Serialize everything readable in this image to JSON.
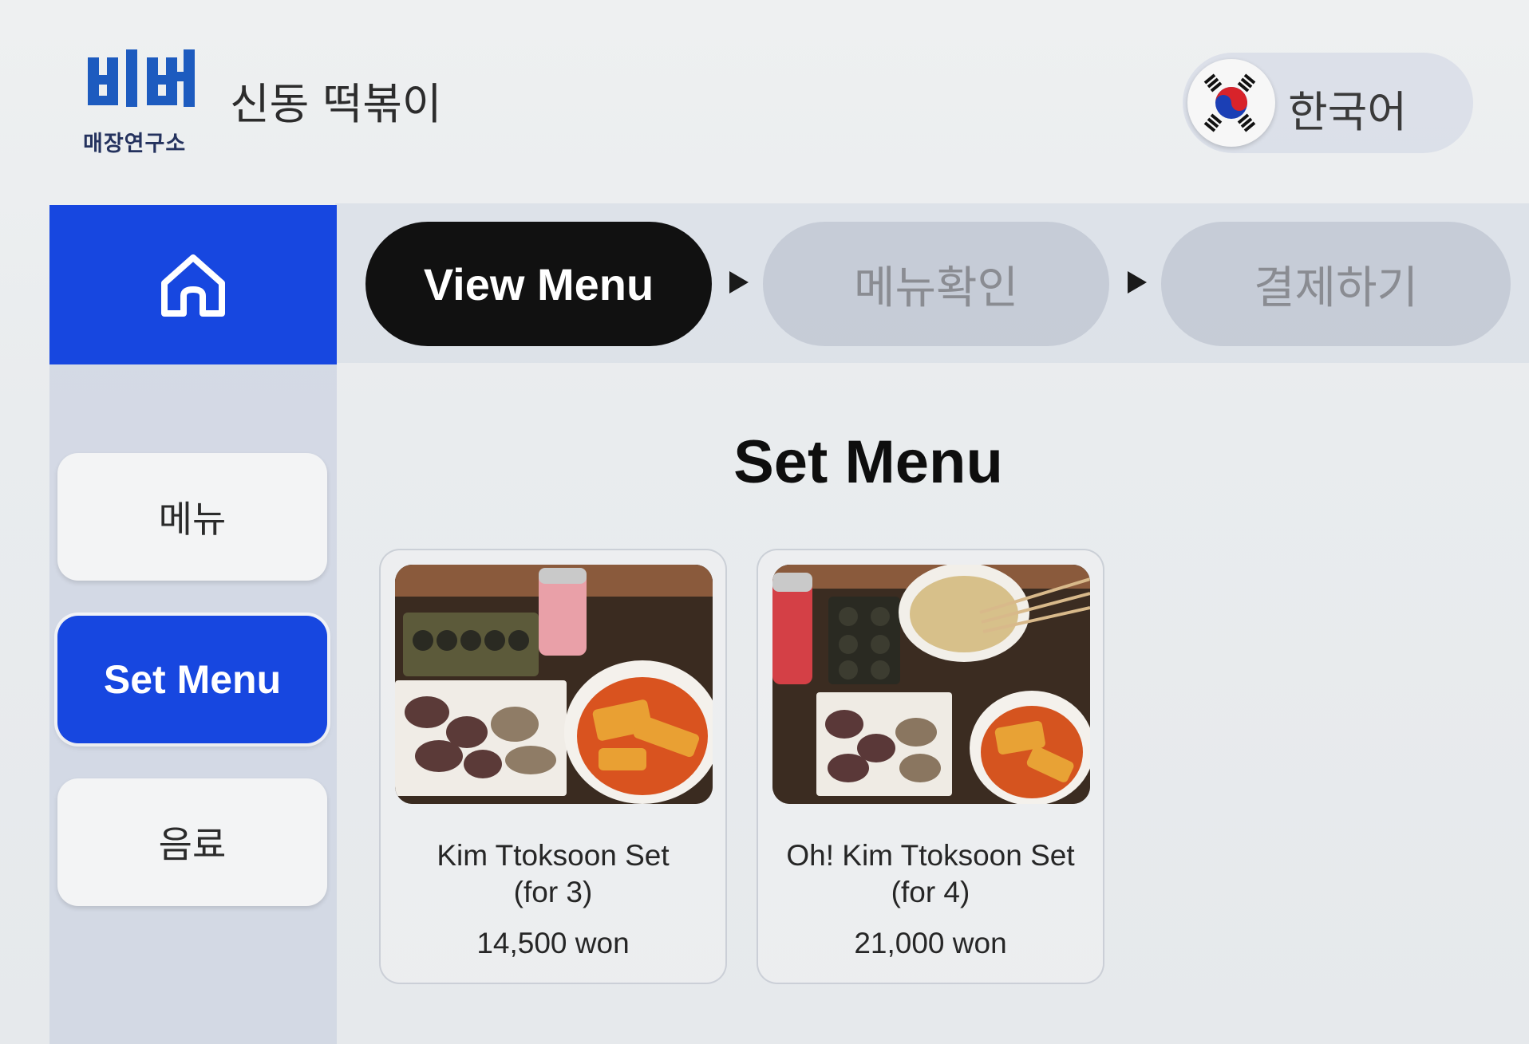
{
  "header": {
    "logo_mark": "비버",
    "logo_sub": "매장연구소",
    "store_name": "신동 떡볶이",
    "language": {
      "label": "한국어",
      "icon": "korea-flag-icon"
    }
  },
  "nav": {
    "home_icon": "home-icon",
    "steps": [
      {
        "label": "View Menu",
        "active": true
      },
      {
        "label": "메뉴확인",
        "active": false
      },
      {
        "label": "결제하기",
        "active": false
      }
    ]
  },
  "sidebar": {
    "categories": [
      {
        "label": "메뉴",
        "selected": false
      },
      {
        "label": "Set Menu",
        "selected": true
      },
      {
        "label": "음료",
        "selected": false
      }
    ]
  },
  "main": {
    "title": "Set Menu",
    "items": [
      {
        "name_line1": "Kim Ttoksoon Set",
        "name_line2": "(for 3)",
        "price": "14,500 won"
      },
      {
        "name_line1": "Oh! Kim Ttoksoon Set",
        "name_line2": "(for 4)",
        "price": "21,000 won"
      }
    ]
  },
  "colors": {
    "accent": "#1747e0",
    "active_step": "#111111",
    "inactive_step": "#bec4d0"
  }
}
